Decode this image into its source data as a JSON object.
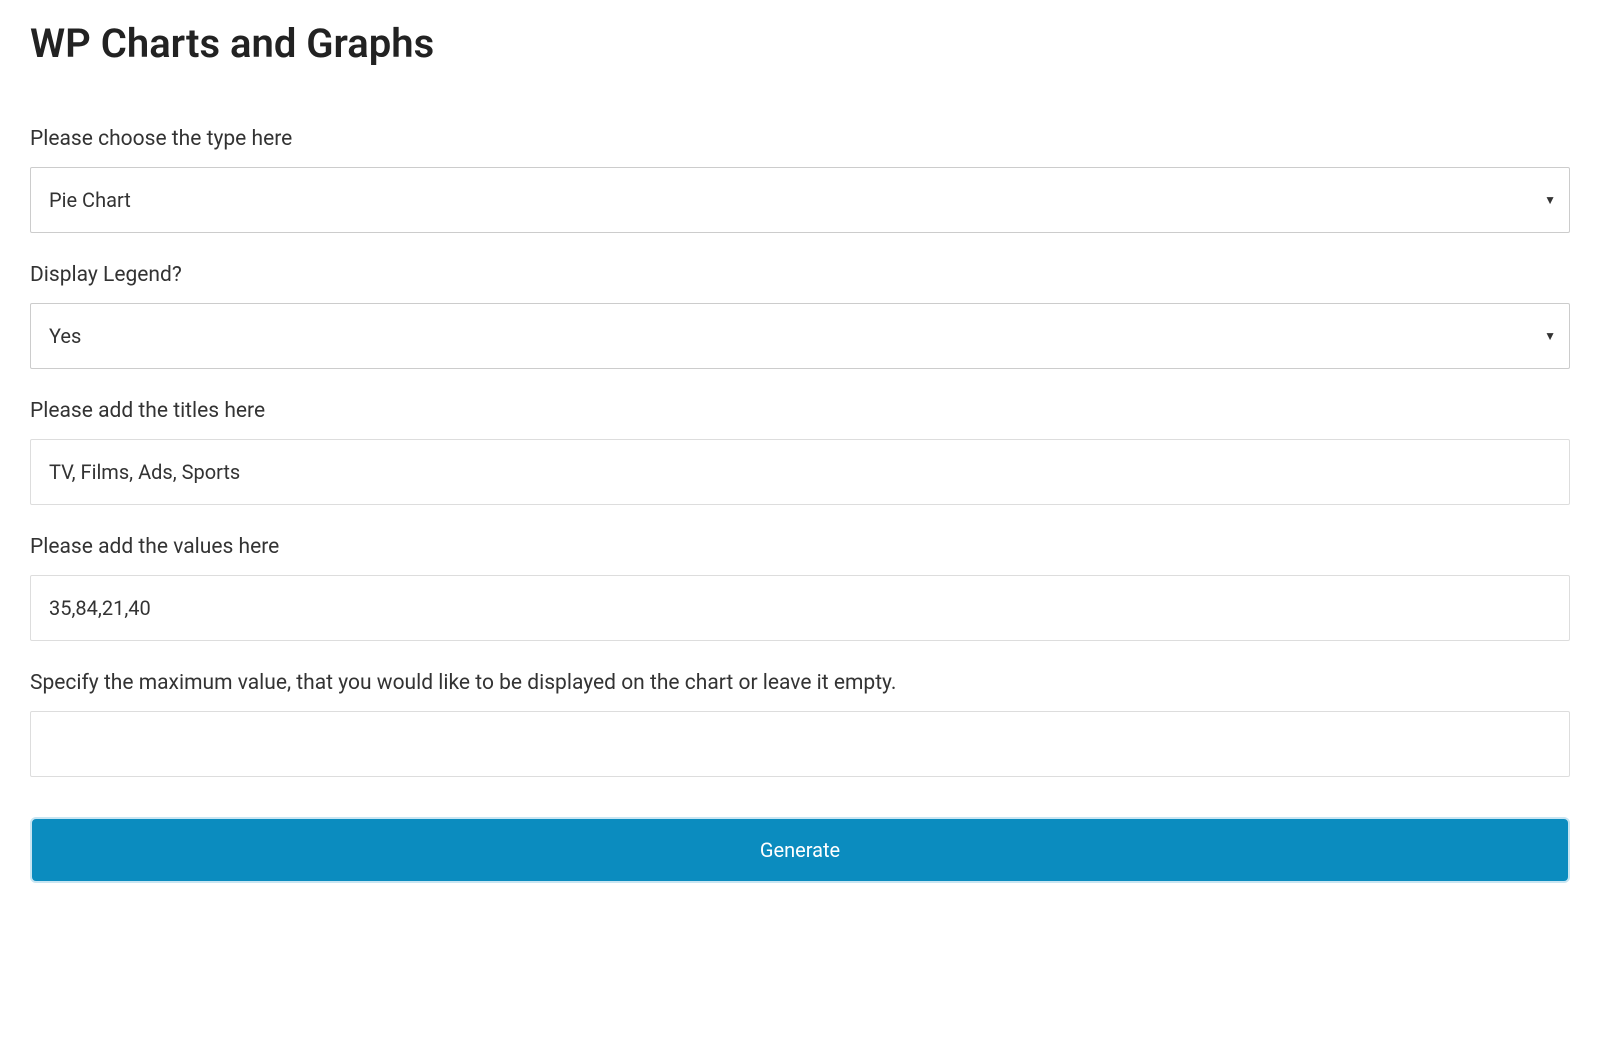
{
  "page": {
    "title": "WP Charts and Graphs"
  },
  "form": {
    "chart_type": {
      "label": "Please choose the type here",
      "value": "Pie Chart"
    },
    "display_legend": {
      "label": "Display Legend?",
      "value": "Yes"
    },
    "titles": {
      "label": "Please add the titles here",
      "value": "TV, Films, Ads, Sports"
    },
    "values": {
      "label": "Please add the values here",
      "value": "35,84,21,40"
    },
    "max_value": {
      "label": "Specify the maximum value, that you would like to be displayed on the chart or leave it empty.",
      "value": ""
    },
    "generate_label": "Generate"
  }
}
